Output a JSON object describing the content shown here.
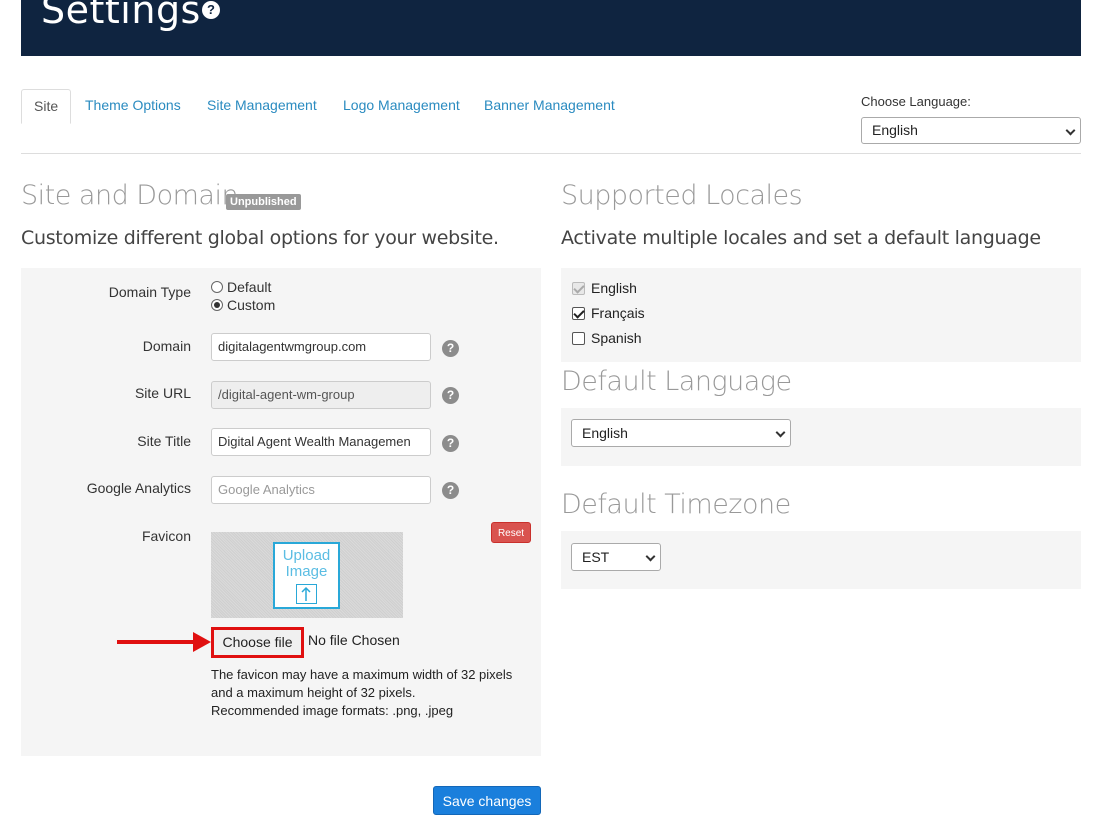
{
  "header": {
    "title": "Settings",
    "help_glyph": "?"
  },
  "tabs": [
    {
      "label": "Site",
      "active": true
    },
    {
      "label": "Theme Options",
      "active": false
    },
    {
      "label": "Site Management",
      "active": false
    },
    {
      "label": "Logo Management",
      "active": false
    },
    {
      "label": "Banner Management",
      "active": false
    }
  ],
  "choose_language": {
    "label": "Choose Language:",
    "selected": "English"
  },
  "site_domain": {
    "title": "Site and Domain",
    "badge": "Unpublished",
    "subtitle": "Customize different global options for your website.",
    "domain_type": {
      "label": "Domain Type",
      "options": [
        "Default",
        "Custom"
      ],
      "selected": "Custom"
    },
    "domain": {
      "label": "Domain",
      "value": "digitalagentwmgroup.com"
    },
    "site_url": {
      "label": "Site URL",
      "value": "/digital-agent-wm-group"
    },
    "site_title": {
      "label": "Site Title",
      "value": "Digital Agent Wealth Managemen"
    },
    "google_analytics": {
      "label": "Google Analytics",
      "placeholder": "Google Analytics"
    },
    "favicon": {
      "label": "Favicon",
      "upload_line1": "Upload",
      "upload_line2": "Image",
      "reset_label": "Reset",
      "choose_label": "Choose file",
      "no_file": "No file Chosen",
      "help_line1": "The favicon may have a maximum width of 32 pixels",
      "help_line2": "and a maximum height of 32 pixels.",
      "help_line3": "Recommended image formats: .png, .jpeg"
    },
    "save_label": "Save changes"
  },
  "locales": {
    "title": "Supported Locales",
    "subtitle": "Activate multiple locales and set a default language",
    "items": [
      {
        "label": "English",
        "checked": true,
        "disabled": true
      },
      {
        "label": "Français",
        "checked": true,
        "disabled": false
      },
      {
        "label": "Spanish",
        "checked": false,
        "disabled": false
      }
    ]
  },
  "default_language": {
    "title": "Default Language",
    "selected": "English"
  },
  "default_timezone": {
    "title": "Default Timezone",
    "selected": "EST"
  },
  "icons": {
    "help": "question-circle-icon",
    "chevron": "chevron-down-icon",
    "upload": "upload-arrow-icon",
    "annotation": "red-arrow-icon"
  },
  "colors": {
    "header_bg": "#0f2440",
    "link": "#2a8bc0",
    "primary": "#1a7fdc",
    "danger": "#d9534f",
    "annotation": "#e01010"
  }
}
